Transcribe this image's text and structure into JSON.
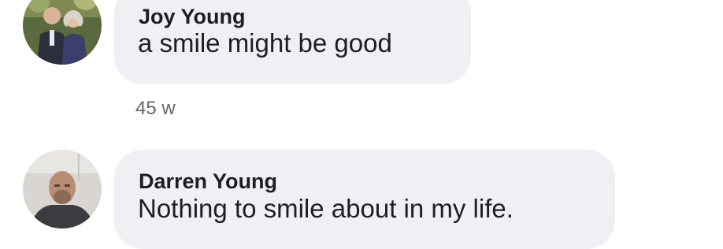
{
  "comments": [
    {
      "author": "Joy Young",
      "text": "a smile might be good",
      "timestamp": "45 w"
    },
    {
      "author": "Darren Young",
      "text": "Nothing to smile about in my life."
    }
  ],
  "icons": {
    "avatar_1": "profile-photo-couple",
    "avatar_2": "profile-photo-man"
  },
  "colors": {
    "bubble": "#eff0f3",
    "text": "#1c1e21",
    "meta": "#65676b",
    "background": "#ffffff"
  }
}
